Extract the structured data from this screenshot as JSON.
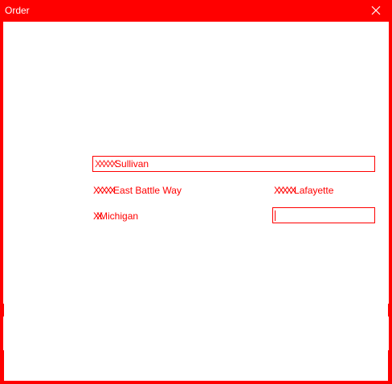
{
  "window": {
    "title": "Order"
  },
  "form": {
    "name_value": "Sullivan",
    "name_prefix_garbled": "XXXXX",
    "street": "East Battle Way",
    "city": "Lafayette",
    "state": "Michigan",
    "zip_value": ""
  },
  "colors": {
    "accent": "#ff0000",
    "background": "#ffffff"
  },
  "icons": {
    "close": "close-icon"
  }
}
